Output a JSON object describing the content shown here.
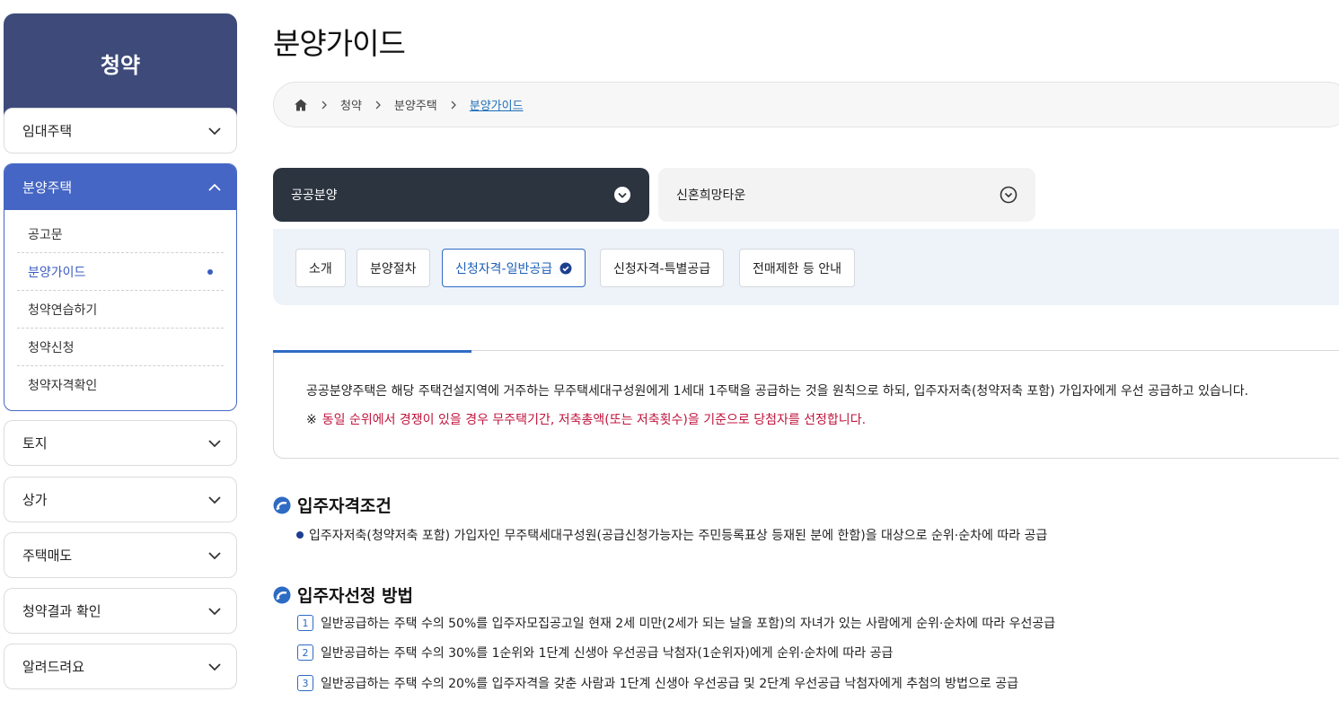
{
  "sidebar": {
    "header": "청약",
    "menu": [
      {
        "label": "임대주택"
      },
      {
        "label": "분양주택"
      },
      {
        "label": "토지"
      },
      {
        "label": "상가"
      },
      {
        "label": "주택매도"
      },
      {
        "label": "청약결과 확인"
      },
      {
        "label": "알려드려요"
      }
    ],
    "submenu": [
      {
        "label": "공고문"
      },
      {
        "label": "분양가이드"
      },
      {
        "label": "청약연습하기"
      },
      {
        "label": "청약신청"
      },
      {
        "label": "청약자격확인"
      }
    ]
  },
  "page": {
    "title": "분양가이드"
  },
  "breadcrumb": {
    "items": [
      "청약",
      "분양주택"
    ],
    "current": "분양가이드"
  },
  "selects": {
    "primary": "공공분양",
    "secondary": "신혼희망타운"
  },
  "tabs": [
    "소개",
    "분양절차",
    "신청자격-일반공급",
    "신청자격-특별공급",
    "전매제한 등 안내"
  ],
  "info": {
    "line1": "공공분양주택은 해당 주택건설지역에 거주하는 무주택세대구성원에게 1세대 1주택을 공급하는 것을 원칙으로 하되, 입주자저축(청약저축 포함) 가입자에게 우선 공급하고 있습니다.",
    "note_mark": "※",
    "line2": "동일 순위에서 경쟁이 있을 경우 무주택기간, 저축총액(또는 저축횟수)을 기준으로 당첨자를 선정합니다."
  },
  "section1": {
    "title": "입주자격조건",
    "bullet": "입주자저축(청약저축 포함) 가입자인 무주택세대구성원(공급신청가능자는 주민등록표상 등재된 분에 한함)을 대상으로 순위·순차에 따라 공급"
  },
  "section2": {
    "title": "입주자선정 방법",
    "items": [
      {
        "num": "1",
        "text": "일반공급하는 주택 수의 50%를 입주자모집공고일 현재 2세 미만(2세가 되는 날을 포함)의 자녀가 있는 사람에게 순위·순차에 따라 우선공급"
      },
      {
        "num": "2",
        "text": "일반공급하는 주택 수의 30%를 1순위와 1단계 신생아 우선공급 낙첨자(1순위자)에게 순위·순차에 따라 공급"
      },
      {
        "num": "3",
        "text": "일반공급하는 주택 수의 20%를 입주자격을 갖춘 사람과 1단계 신생아 우선공급 및 2단계 우선공급 낙첨자에게 추첨의 방법으로 공급"
      }
    ]
  },
  "colors": {
    "sidebar_header": "#3d4a7a",
    "accent": "#4566c4",
    "dark_select": "#2c3440",
    "notice_red": "#c0143c"
  }
}
